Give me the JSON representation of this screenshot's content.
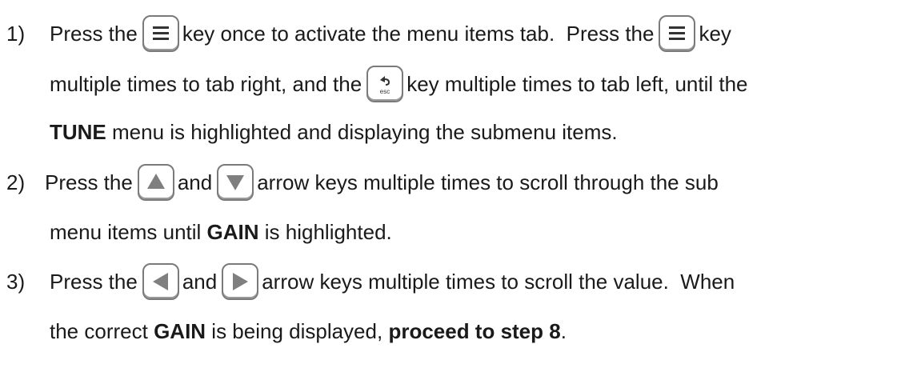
{
  "steps": [
    {
      "number": "1)",
      "line1": {
        "a": "Press the",
        "b": "key once to activate the menu items tab.  Press the",
        "c": "key"
      },
      "line2": {
        "a": "multiple times to tab right, and the",
        "b": "key multiple times to tab left, until the"
      },
      "line3": {
        "bold": "TUNE",
        "rest": " menu is highlighted and displaying the submenu items."
      }
    },
    {
      "number": "2)",
      "line1": {
        "a": "Press the",
        "b": "and",
        "c": "arrow keys multiple times to scroll through the sub"
      },
      "line2": {
        "a": "menu items until ",
        "bold": "GAIN",
        "b": " is highlighted."
      }
    },
    {
      "number": "3)",
      "line1": {
        "a": "Press the",
        "b": "and",
        "c": "arrow keys multiple times to scroll the value.  When"
      },
      "line2": {
        "a": "the correct ",
        "bold1": "GAIN",
        "b": " is being displayed, ",
        "bold2": "proceed to step 8",
        "c": "."
      }
    }
  ],
  "icons": {
    "menu": "menu-icon",
    "esc": "esc-back-icon",
    "up": "up-arrow-icon",
    "down": "down-arrow-icon",
    "left": "left-arrow-icon",
    "right": "right-arrow-icon",
    "esc_label": "esc"
  },
  "colors": {
    "text": "#1a1a1a",
    "key_border": "#7a7a7a",
    "arrow_fill": "#7f7f7f"
  }
}
